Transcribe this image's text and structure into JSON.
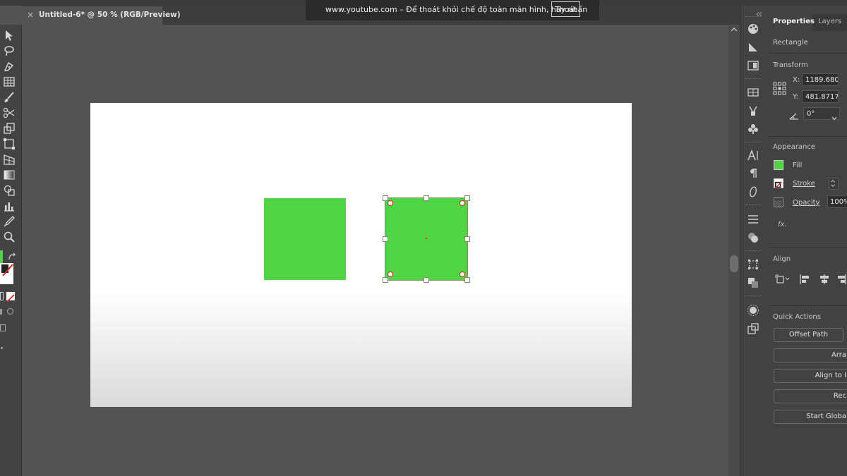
{
  "document": {
    "tab_title": "Untitled-6* @ 50 % (RGB/Preview)",
    "close_glyph": "×"
  },
  "fullscreen_notice": {
    "message": "www.youtube.com – Để thoát khỏi chế độ toàn màn hình, hãy nhấn",
    "exit_label": "Thoát"
  },
  "artwork": {
    "fill_color": "#4fd543"
  },
  "panel": {
    "tabs": [
      "Properties",
      "Layers"
    ],
    "selection_type": "Rectangle",
    "transform": {
      "heading": "Transform",
      "x_label": "X:",
      "x_value": "1189.680",
      "y_label": "Y:",
      "y_value": "481.8717",
      "angle_value": "0°"
    },
    "appearance": {
      "heading": "Appearance",
      "fill_label": "Fill",
      "stroke_label": "Stroke",
      "opacity_label": "Opacity",
      "opacity_value": "100%",
      "fx_label": "fx."
    },
    "align": {
      "heading": "Align"
    },
    "quick_actions": {
      "heading": "Quick Actions",
      "buttons": [
        "Offset Path",
        "Arra",
        "Align to I",
        "Rec",
        "Start Globa"
      ]
    }
  },
  "icons": {
    "left_toolbar": [
      "selection-tool-icon",
      "lasso-tool-icon",
      "pen-tool-icon",
      "grid-tool-icon",
      "paintbrush-tool-icon",
      "scissors-tool-icon",
      "scale-tool-icon",
      "free-transform-tool-icon",
      "perspective-tool-icon",
      "gradient-tool-icon",
      "shape-builder-tool-icon",
      "graph-tool-icon",
      "eyedropper-tool-icon",
      "zoom-tool-icon"
    ]
  }
}
